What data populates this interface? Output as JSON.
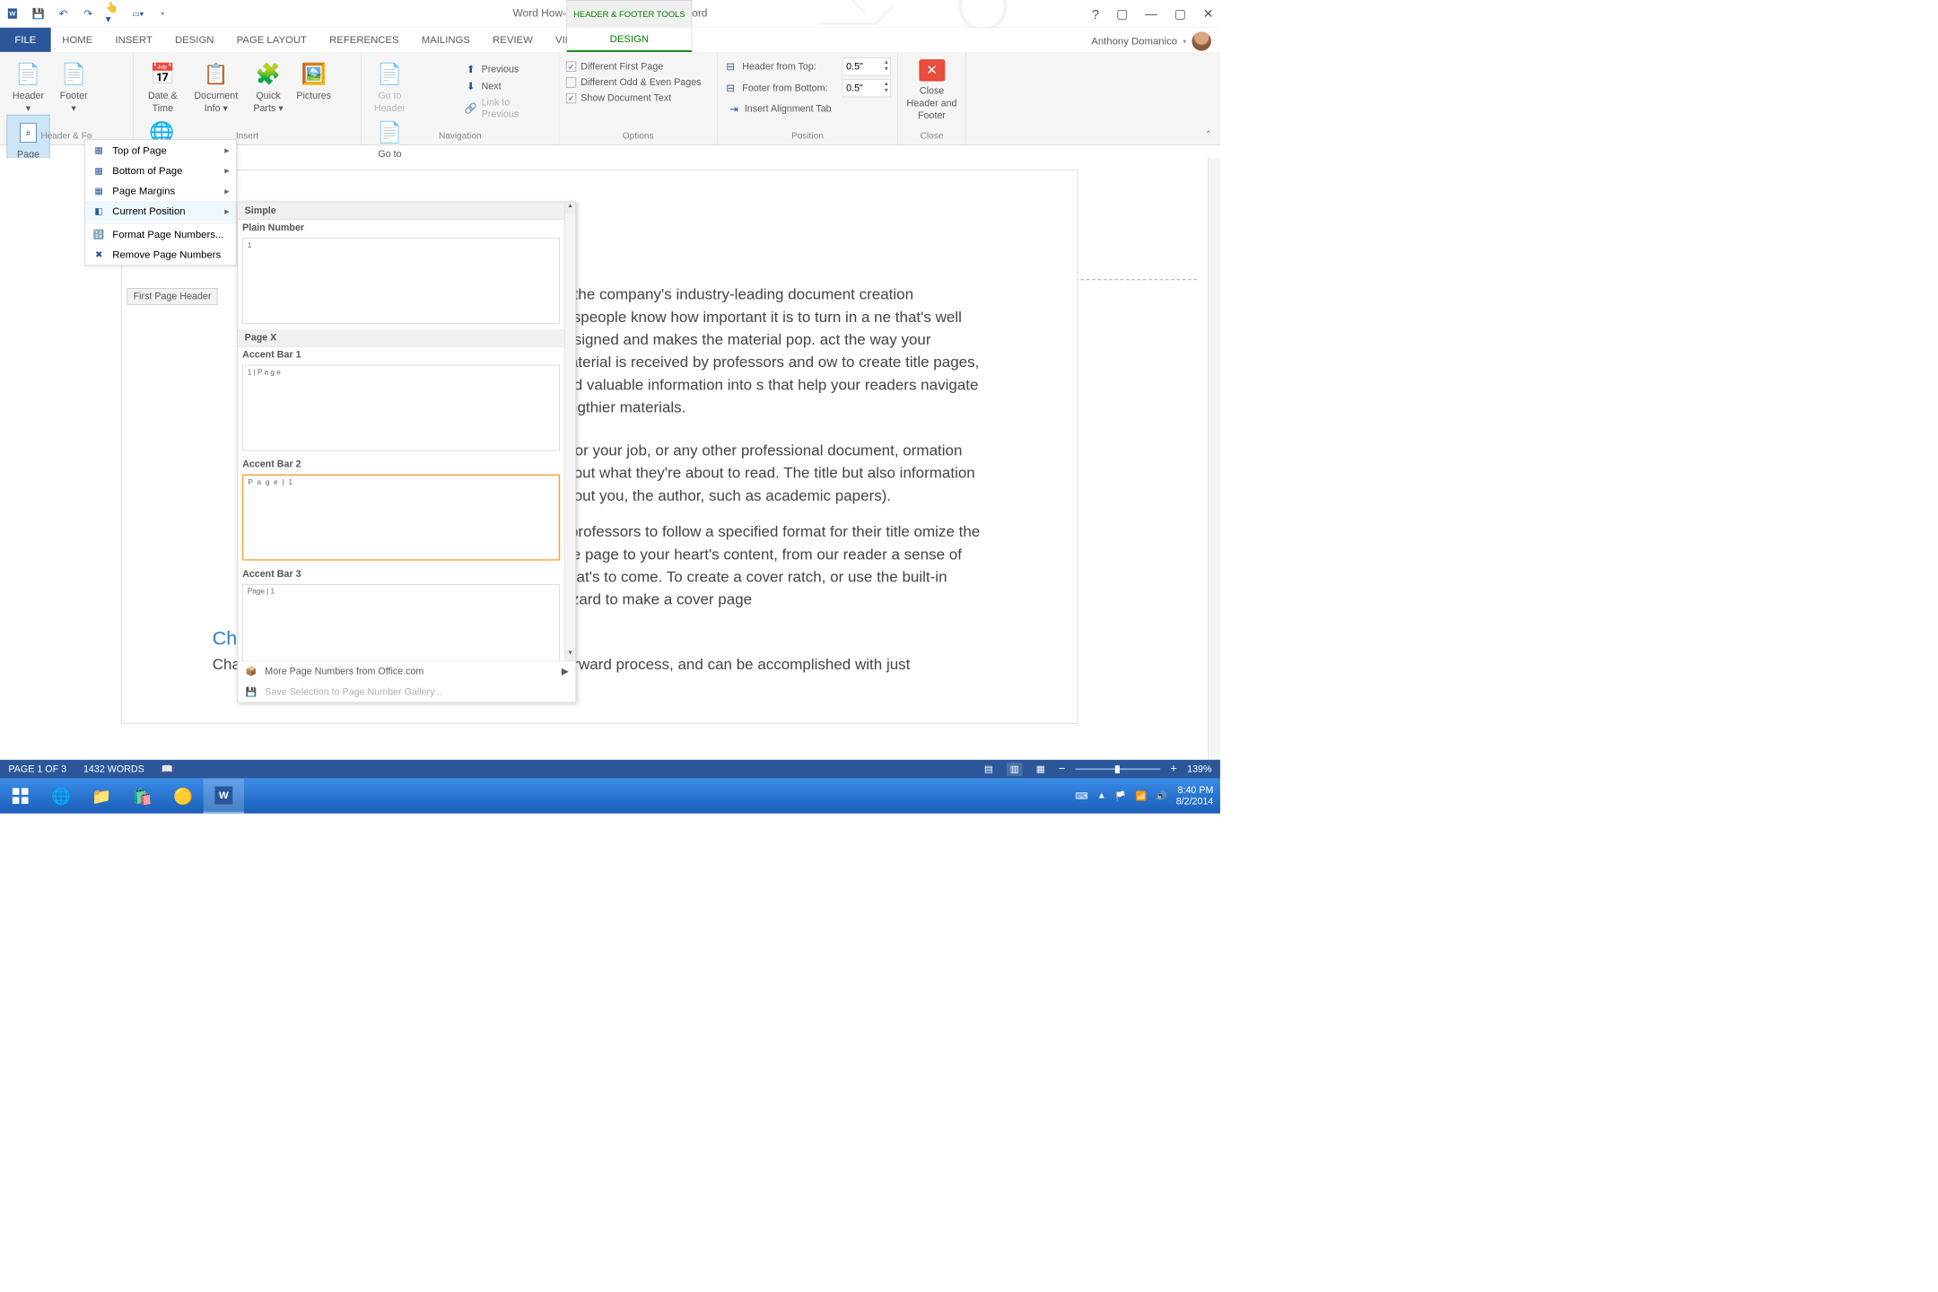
{
  "title": "Word How-To Article August 2014 - Word",
  "contextual_tab": "HEADER & FOOTER TOOLS",
  "account_name": "Anthony Domanico",
  "menu": {
    "file": "FILE",
    "home": "HOME",
    "insert": "INSERT",
    "design": "DESIGN",
    "page_layout": "PAGE LAYOUT",
    "references": "REFERENCES",
    "mailings": "MAILINGS",
    "review": "REVIEW",
    "view": "VIEW",
    "design_ctx": "DESIGN"
  },
  "ribbon": {
    "hf": {
      "header": "Header",
      "footer": "Footer",
      "page_number": "Page Number",
      "group": "Header & Fo"
    },
    "insert": {
      "date_time": "Date & Time",
      "doc_info": "Document Info",
      "quick_parts": "Quick Parts",
      "pictures": "Pictures",
      "online_pics": "Online Pictures",
      "group": "Insert"
    },
    "nav": {
      "goto_header": "Go to Header",
      "goto_footer": "Go to Footer",
      "previous": "Previous",
      "next": "Next",
      "link": "Link to Previous",
      "group": "Navigation"
    },
    "options": {
      "diff_first": "Different First Page",
      "diff_oe": "Different Odd & Even Pages",
      "show_doc": "Show Document Text",
      "group": "Options"
    },
    "position": {
      "header_top": "Header from Top:",
      "footer_bottom": "Footer from Bottom:",
      "align_tab": "Insert Alignment Tab",
      "val1": "0.5\"",
      "val2": "0.5\"",
      "group": "Position"
    },
    "close": {
      "label": "Close Header and Footer",
      "group": "Close"
    }
  },
  "pn_menu": {
    "top": "Top of Page",
    "bottom": "Bottom of Page",
    "margins": "Page Margins",
    "current": "Current Position",
    "format": "Format Page Numbers...",
    "remove": "Remove Page Numbers"
  },
  "gallery": {
    "cat_simple": "Simple",
    "plain_number": "Plain Number",
    "plain_preview": "1",
    "cat_pagex": "Page X",
    "accent1": "Accent Bar 1",
    "accent1_preview": "1 | P a g e",
    "accent2": "Accent Bar 2",
    "accent2_preview": "P a g e  | 1",
    "accent3": "Accent Bar 3",
    "accent3_preview": "Page | 1",
    "more": "More Page Numbers from Office.com",
    "save_sel": "Save Selection to Page Number Gallery..."
  },
  "header_tab": "First Page Header",
  "doc": {
    "p1": "3, the company's industry-leading document creation esspeople know how important it is to turn in a ne that's well designed and makes the material pop. act the way your material is received by professors and ow to create title pages, add valuable information into s that help your readers navigate lengthier materials.",
    "p2": "rt for your job, or any other professional document, ormation about what they're about to read. The title but also information about you, the author, such as academic papers).",
    "p3": "d professors to follow a specified format for their title omize the title page to your heart's content, from our reader a sense of what's to come. To create a cover ratch, or use the built-in wizard to make a cover page",
    "h2": "Changing the Font",
    "p4": "Changing fonts on your title page is a pretty straightforward process, and can be accomplished with just"
  },
  "status": {
    "page": "PAGE 1 OF 3",
    "words": "1432 WORDS",
    "zoom": "139%"
  },
  "taskbar": {
    "time": "8:40 PM",
    "date": "8/2/2014"
  }
}
